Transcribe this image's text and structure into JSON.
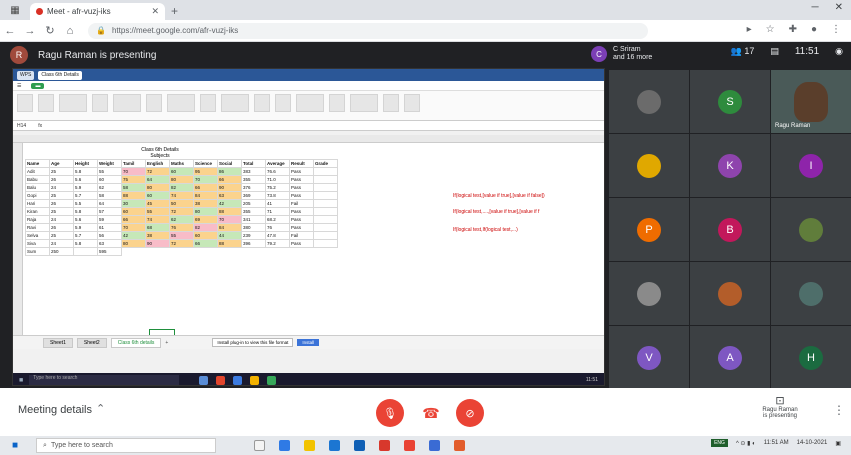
{
  "browser": {
    "tab_title": "Meet - afr-vuzj-iks",
    "url": "https://meet.google.com/afr-vuzj-iks"
  },
  "meet": {
    "presenter_initial": "R",
    "presenting_text": "Ragu Raman is presenting",
    "host_initial": "C",
    "host_name": "C Sriram",
    "host_sub": "and 16 more",
    "time": "11:51",
    "participant_count": "17",
    "meeting_details": "Meeting details",
    "presenter_label_name": "Ragu Raman",
    "presenter_label_sub": "is presenting"
  },
  "shared_screen": {
    "sheet_title": "Class 6th Details",
    "sheet_subtitle": "Subjects",
    "name_box": "H14",
    "headers": [
      "Name",
      "Age",
      "Height",
      "Weight",
      "Tamil",
      "English",
      "Maths",
      "Science",
      "Social",
      "Total",
      "Average",
      "Result",
      "Grade"
    ],
    "rows": [
      [
        "Adit",
        "25",
        "5.8",
        "55",
        "70",
        "72",
        "60",
        "95",
        "86",
        "383",
        "76.6",
        "Pass",
        ""
      ],
      [
        "Babu",
        "26",
        "5.6",
        "60",
        "75",
        "64",
        "80",
        "70",
        "66",
        "355",
        "71.0",
        "Pass",
        ""
      ],
      [
        "Balu",
        "24",
        "5.9",
        "62",
        "58",
        "80",
        "82",
        "66",
        "90",
        "376",
        "75.2",
        "Pass",
        ""
      ],
      [
        "Gopi",
        "25",
        "5.7",
        "58",
        "88",
        "60",
        "74",
        "84",
        "63",
        "369",
        "73.8",
        "Pass",
        ""
      ],
      [
        "Hari",
        "26",
        "5.5",
        "64",
        "30",
        "45",
        "50",
        "38",
        "42",
        "205",
        "41",
        "Fail",
        ""
      ],
      [
        "Kiran",
        "25",
        "5.8",
        "57",
        "60",
        "55",
        "72",
        "80",
        "88",
        "355",
        "71",
        "Pass",
        ""
      ],
      [
        "Raja",
        "24",
        "5.6",
        "59",
        "66",
        "74",
        "62",
        "69",
        "70",
        "341",
        "68.2",
        "Pass",
        ""
      ],
      [
        "Ravi",
        "26",
        "5.9",
        "61",
        "70",
        "68",
        "76",
        "82",
        "84",
        "380",
        "76",
        "Pass",
        ""
      ],
      [
        "Selva",
        "25",
        "5.7",
        "56",
        "42",
        "38",
        "55",
        "60",
        "44",
        "239",
        "47.8",
        "Fail",
        ""
      ],
      [
        "Siva",
        "24",
        "5.8",
        "63",
        "80",
        "90",
        "72",
        "66",
        "88",
        "396",
        "79.2",
        "Pass",
        ""
      ]
    ],
    "extra_row": [
      "Sum",
      "250",
      "",
      "595"
    ],
    "notes": [
      "If(logical test,[value if true],[value if false])",
      "If(logical test,....,[value if true],[value if f",
      "If(logical test,If(logical test,...)"
    ],
    "sheet_tabs": [
      "Sheet1",
      "Sheet2"
    ],
    "active_tab": "Class 6th details",
    "toast_text": "Install plug-in to view this file format",
    "toast_button": "Install",
    "search_placeholder": "Type here to search",
    "clock": "11:51"
  },
  "participants": [
    {
      "initial": "",
      "color": "#6b6b6b",
      "name": ""
    },
    {
      "initial": "S",
      "color": "#2e8b3d",
      "name": ""
    },
    {
      "initial": "",
      "color": "#6b6b6b",
      "name": "Ragu Raman",
      "video": true
    },
    {
      "initial": "",
      "color": "#e0a800",
      "name": ""
    },
    {
      "initial": "K",
      "color": "#8e44ad",
      "name": ""
    },
    {
      "initial": "I",
      "color": "#8e24aa",
      "name": ""
    },
    {
      "initial": "P",
      "color": "#ef6c00",
      "name": ""
    },
    {
      "initial": "B",
      "color": "#c2185b",
      "name": ""
    },
    {
      "initial": "",
      "color": "#607d3b",
      "name": ""
    },
    {
      "initial": "",
      "color": "#8a8a8a",
      "name": ""
    },
    {
      "initial": "",
      "color": "#b35d2a",
      "name": ""
    },
    {
      "initial": "",
      "color": "#4e6e6a",
      "name": ""
    },
    {
      "initial": "V",
      "color": "#7e57c2",
      "name": ""
    },
    {
      "initial": "A",
      "color": "#7e57c2",
      "name": ""
    },
    {
      "initial": "H",
      "color": "#1b6b40",
      "name": ""
    }
  ],
  "taskbar": {
    "search_placeholder": "Type here to search",
    "lang": "ENG",
    "time": "11:51 AM",
    "date": "14-10-2021"
  }
}
